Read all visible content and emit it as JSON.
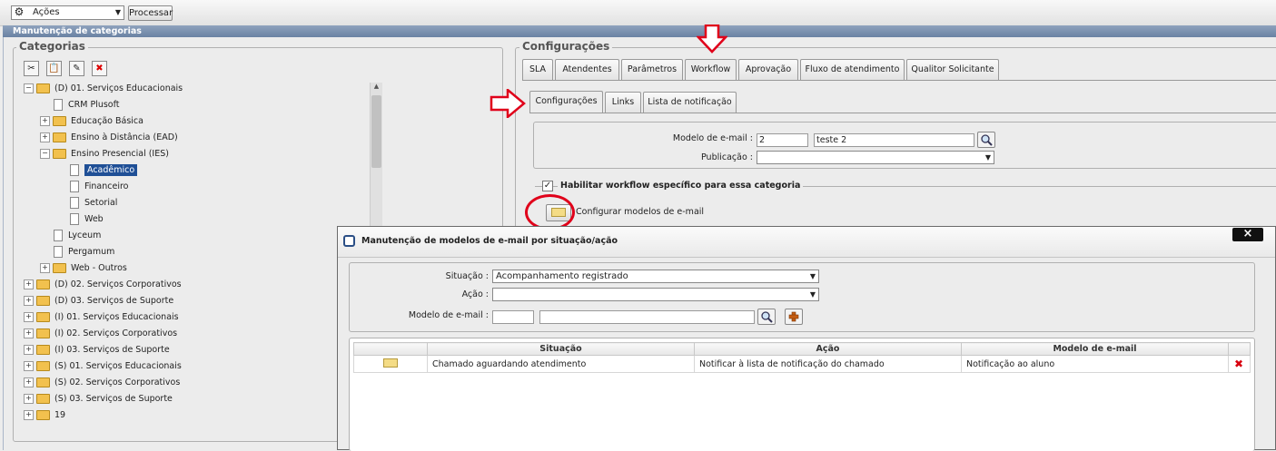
{
  "toolbar": {
    "actions_select": "Ações",
    "process_button": "Processar"
  },
  "window": {
    "title": "Manutenção de categorias"
  },
  "categories": {
    "legend": "Categorias",
    "tree": [
      {
        "label": "(D) 01. Serviços Educacionais",
        "level": 0,
        "type": "folder-open",
        "toggle": "−"
      },
      {
        "label": "CRM Plusoft",
        "level": 1,
        "type": "doc"
      },
      {
        "label": "Educação Básica",
        "level": 1,
        "type": "folder",
        "toggle": "+"
      },
      {
        "label": "Ensino à Distância (EAD)",
        "level": 1,
        "type": "folder",
        "toggle": "+"
      },
      {
        "label": "Ensino Presencial (IES)",
        "level": 1,
        "type": "folder-open",
        "toggle": "−"
      },
      {
        "label": "Acadêmico",
        "level": 2,
        "type": "doc",
        "selected": true
      },
      {
        "label": "Financeiro",
        "level": 2,
        "type": "doc"
      },
      {
        "label": "Setorial",
        "level": 2,
        "type": "doc"
      },
      {
        "label": "Web",
        "level": 2,
        "type": "doc"
      },
      {
        "label": "Lyceum",
        "level": 1,
        "type": "doc"
      },
      {
        "label": "Pergamum",
        "level": 1,
        "type": "doc"
      },
      {
        "label": "Web - Outros",
        "level": 1,
        "type": "folder",
        "toggle": "+"
      },
      {
        "label": "(D) 02. Serviços Corporativos",
        "level": 0,
        "type": "folder",
        "toggle": "+"
      },
      {
        "label": "(D) 03. Serviços de Suporte",
        "level": 0,
        "type": "folder",
        "toggle": "+"
      },
      {
        "label": "(I) 01. Serviços Educacionais",
        "level": 0,
        "type": "folder",
        "toggle": "+"
      },
      {
        "label": "(I) 02. Serviços Corporativos",
        "level": 0,
        "type": "folder",
        "toggle": "+"
      },
      {
        "label": "(I) 03. Serviços de Suporte",
        "level": 0,
        "type": "folder",
        "toggle": "+"
      },
      {
        "label": "(S) 01. Serviços Educacionais",
        "level": 0,
        "type": "folder",
        "toggle": "+"
      },
      {
        "label": "(S) 02. Serviços Corporativos",
        "level": 0,
        "type": "folder",
        "toggle": "+"
      },
      {
        "label": "(S) 03. Serviços de Suporte",
        "level": 0,
        "type": "folder",
        "toggle": "+"
      },
      {
        "label": "19",
        "level": 0,
        "type": "folder",
        "toggle": "+"
      }
    ]
  },
  "config": {
    "legend": "Configurações",
    "tabs": [
      "SLA",
      "Atendentes",
      "Parâmetros",
      "Workflow",
      "Aprovação",
      "Fluxo de atendimento",
      "Qualitor Solicitante"
    ],
    "active_tab": "Workflow",
    "subtabs": [
      "Configurações",
      "Links",
      "Lista de notificação"
    ],
    "email_model_label": "Modelo de e-mail :",
    "email_model_code": "2",
    "email_model_name": "teste 2",
    "publication_label": "Publicação :",
    "enable_workflow_label": "Habilitar workflow específico para essa categoria",
    "configure_models_label": "Configurar modelos de e-mail"
  },
  "modal": {
    "title": "Manutenção de modelos de e-mail por situação/ação",
    "close": "×",
    "situation_label": "Situação :",
    "situation_value": "Acompanhamento registrado",
    "action_label": "Ação :",
    "action_value": "",
    "email_model_label": "Modelo de e-mail :",
    "grid": {
      "headers": [
        "Situação",
        "Ação",
        "Modelo de e-mail"
      ],
      "rows": [
        {
          "situacao": "Chamado aguardando atendimento",
          "acao": "Notificar à lista de notificação do chamado",
          "modelo": "Notificação ao aluno"
        }
      ]
    }
  },
  "colors": {
    "accent_red": "#e0001a",
    "selection": "#1f4f96",
    "titlebar": "#7b90ae"
  }
}
